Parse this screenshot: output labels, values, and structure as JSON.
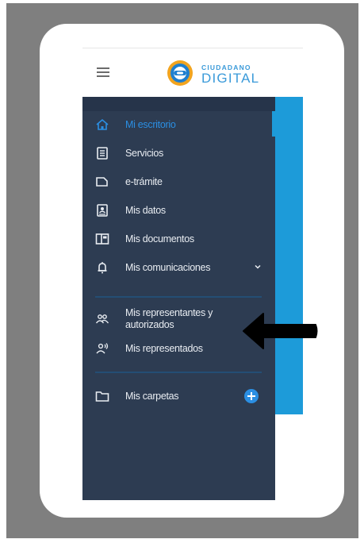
{
  "header": {
    "logo_top": "CIUDADANO",
    "logo_bottom": "DIGITAL",
    "logo_icon": "ciudadano-digital-logo",
    "menu_icon": "hamburger-icon"
  },
  "sidebar": {
    "items": [
      {
        "label": "Mi escritorio",
        "icon": "home-icon",
        "active": true
      },
      {
        "label": "Servicios",
        "icon": "list-icon"
      },
      {
        "label": "e-trámite",
        "icon": "folder-tab-icon"
      },
      {
        "label": "Mis datos",
        "icon": "id-card-icon"
      },
      {
        "label": "Mis documentos",
        "icon": "documents-icon"
      },
      {
        "label": "Mis comunicaciones",
        "icon": "bell-icon",
        "expandable": true
      },
      {
        "label": "Mis representantes y autorizados",
        "label_line1": "Mis representantes y",
        "label_line2": "autorizados",
        "icon": "users-icon"
      },
      {
        "label": "Mis representados",
        "icon": "user-broadcast-icon"
      },
      {
        "label": "Mis carpetas",
        "icon": "folder-icon",
        "action_icon": "add-circle-icon"
      }
    ]
  },
  "annotation": {
    "icon": "black-arrow-left"
  },
  "colors": {
    "frame_gray": "#7f7f7f",
    "sidebar_bg": "#2d3c52",
    "accent_blue": "#1d9bd9",
    "active_text": "#2b8fe3",
    "logo_blue": "#3a9ad9"
  }
}
